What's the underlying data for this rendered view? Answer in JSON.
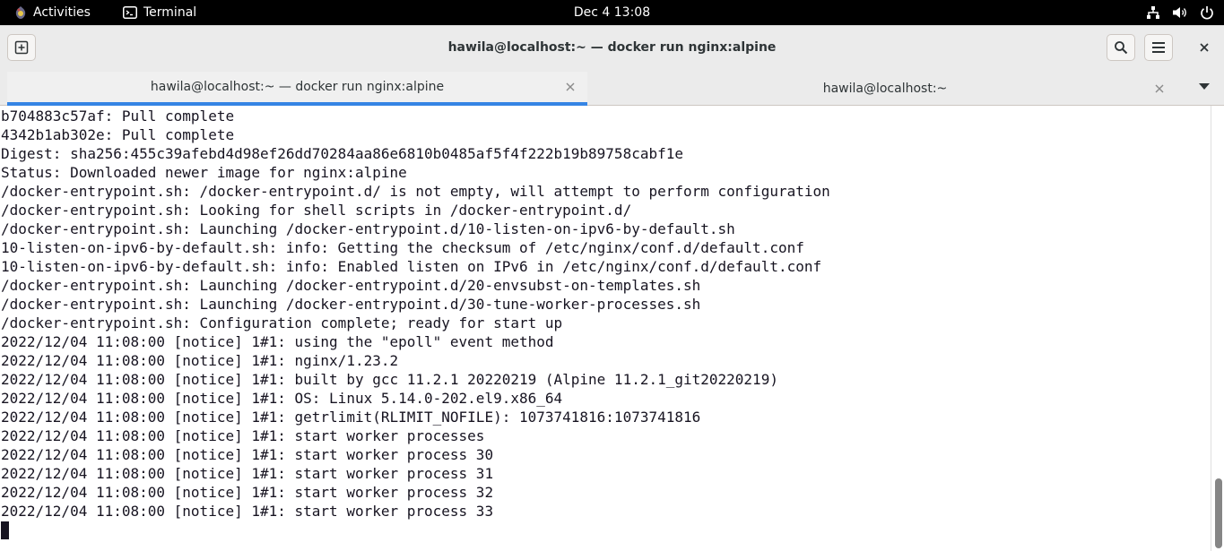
{
  "topbar": {
    "activities_label": "Activities",
    "app_label": "Terminal",
    "clock": "Dec 4  13:08",
    "tray_icons": [
      "network-icon",
      "volume-icon",
      "power-icon"
    ]
  },
  "window": {
    "title": "hawila@localhost:~ — docker run nginx:alpine",
    "new_tab_icon": "new-tab-icon",
    "search_icon": "search-icon",
    "menu_icon": "hamburger-menu-icon",
    "close_icon": "close-icon"
  },
  "tabs": [
    {
      "label": "hawila@localhost:~ — docker run nginx:alpine",
      "active": true
    },
    {
      "label": "hawila@localhost:~",
      "active": false
    }
  ],
  "terminal": {
    "lines": [
      "b704883c57af: Pull complete",
      "4342b1ab302e: Pull complete",
      "Digest: sha256:455c39afebd4d98ef26dd70284aa86e6810b0485af5f4f222b19b89758cabf1e",
      "Status: Downloaded newer image for nginx:alpine",
      "/docker-entrypoint.sh: /docker-entrypoint.d/ is not empty, will attempt to perform configuration",
      "/docker-entrypoint.sh: Looking for shell scripts in /docker-entrypoint.d/",
      "/docker-entrypoint.sh: Launching /docker-entrypoint.d/10-listen-on-ipv6-by-default.sh",
      "10-listen-on-ipv6-by-default.sh: info: Getting the checksum of /etc/nginx/conf.d/default.conf",
      "10-listen-on-ipv6-by-default.sh: info: Enabled listen on IPv6 in /etc/nginx/conf.d/default.conf",
      "/docker-entrypoint.sh: Launching /docker-entrypoint.d/20-envsubst-on-templates.sh",
      "/docker-entrypoint.sh: Launching /docker-entrypoint.d/30-tune-worker-processes.sh",
      "/docker-entrypoint.sh: Configuration complete; ready for start up",
      "2022/12/04 11:08:00 [notice] 1#1: using the \"epoll\" event method",
      "2022/12/04 11:08:00 [notice] 1#1: nginx/1.23.2",
      "2022/12/04 11:08:00 [notice] 1#1: built by gcc 11.2.1 20220219 (Alpine 11.2.1_git20220219)",
      "2022/12/04 11:08:00 [notice] 1#1: OS: Linux 5.14.0-202.el9.x86_64",
      "2022/12/04 11:08:00 [notice] 1#1: getrlimit(RLIMIT_NOFILE): 1073741816:1073741816",
      "2022/12/04 11:08:00 [notice] 1#1: start worker processes",
      "2022/12/04 11:08:00 [notice] 1#1: start worker process 30",
      "2022/12/04 11:08:00 [notice] 1#1: start worker process 31",
      "2022/12/04 11:08:00 [notice] 1#1: start worker process 32",
      "2022/12/04 11:08:00 [notice] 1#1: start worker process 33"
    ]
  },
  "colors": {
    "accent": "#3584e4",
    "topbar_bg": "#000000",
    "headerbar_bg": "#ebebeb",
    "terminal_bg": "#ffffff",
    "terminal_fg": "#171421"
  }
}
